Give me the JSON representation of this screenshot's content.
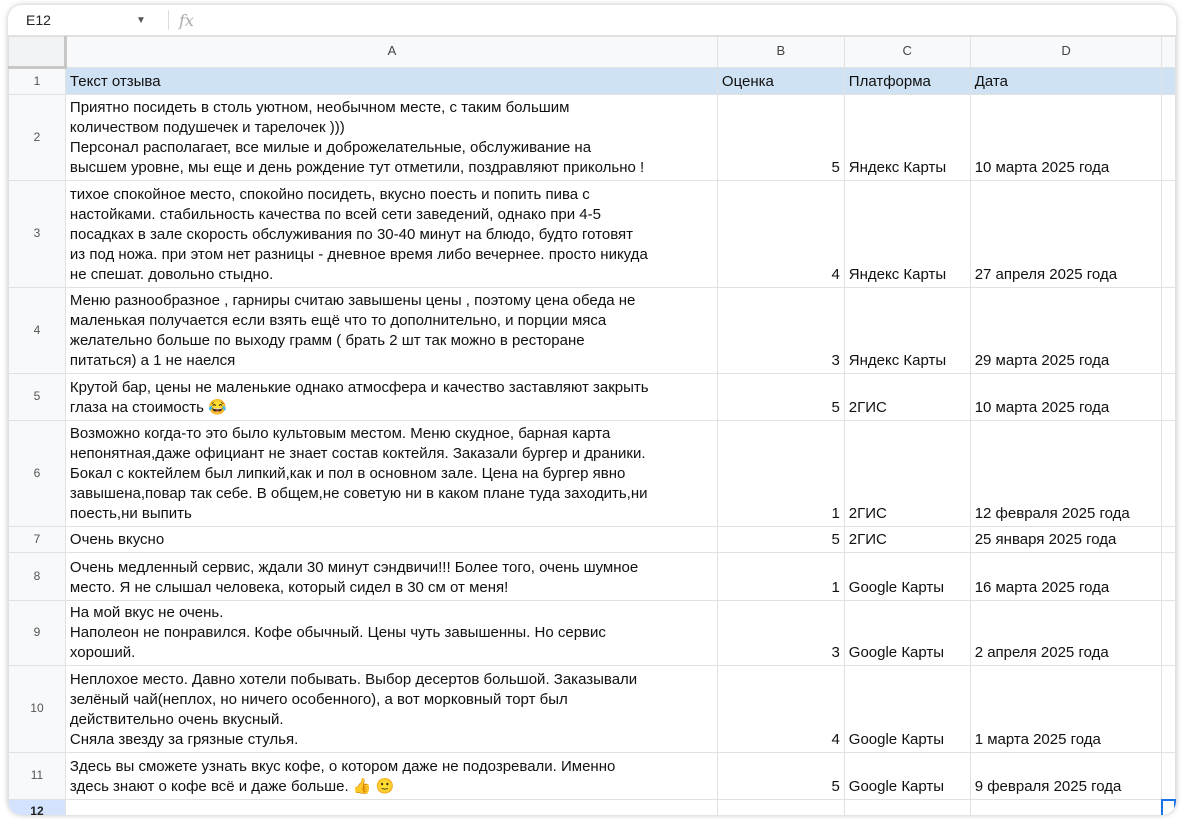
{
  "formula_bar": {
    "cell_ref": "E12",
    "fx_label": "fx"
  },
  "columns": [
    "A",
    "B",
    "C",
    "D"
  ],
  "header": {
    "row": "1",
    "cells": [
      "Текст отзыва",
      "Оценка",
      "Платформа",
      "Дата"
    ]
  },
  "rows": [
    {
      "row": "2",
      "text": "Приятно посидеть в столь уютном, необычном месте, с таким большим\nколичеством подушечек и тарелочек )))\nПерсонал располагает, все милые и доброжелательные, обслуживание на\nвысшем уровне, мы еще и день рождение тут отметили, поздравляют прикольно !",
      "rating": "5",
      "platform": "Яндекс Карты",
      "date": "10 марта 2025 года"
    },
    {
      "row": "3",
      "text": "тихое спокойное место, спокойно посидеть, вкусно поесть и попить пива с\nнастойками. стабильность качества по всей сети заведений, однако при 4-5\nпосадках в зале скорость обслуживания по 30-40 минут на блюдо, будто готовят\nиз под ножа. при этом нет разницы - дневное время либо вечернее. просто никуда\nне спешат. довольно стыдно.",
      "rating": "4",
      "platform": "Яндекс Карты",
      "date": "27 апреля 2025 года"
    },
    {
      "row": "4",
      "text": "Меню разнообразное , гарниры считаю завышены цены , поэтому цена обеда не\nмаленькая получается если взять ещё что то дополнительно, и порции мяса\nжелательно больше по выходу грамм ( брать 2 шт так можно в ресторане\nпитаться) а 1 не наелся",
      "rating": "3",
      "platform": "Яндекс Карты",
      "date": "29 марта 2025 года"
    },
    {
      "row": "5",
      "text": "Крутой бар, цены не маленькие однако атмосфера и качество заставляют закрыть\nглаза на стоимость 😂",
      "rating": "5",
      "platform": "2ГИС",
      "date": "10 марта 2025 года"
    },
    {
      "row": "6",
      "text": "Возможно когда-то это было культовым местом. Меню скудное, барная карта\nнепонятная,даже официант не знает состав коктейля. Заказали бургер и драники.\nБокал с коктейлем был липкий,как и пол в основном зале. Цена на бургер явно\nзавышена,повар так себе. В общем,не советую ни в каком плане туда заходить,ни\nпоесть,ни выпить",
      "rating": "1",
      "platform": "2ГИС",
      "date": "12 февраля 2025 года"
    },
    {
      "row": "7",
      "text": "Очень вкусно",
      "rating": "5",
      "platform": "2ГИС",
      "date": "25 января 2025 года"
    },
    {
      "row": "8",
      "text": "Очень медленный сервис, ждали 30 минут сэндвичи!!! Более того, очень шумное\nместо. Я не слышал человека, который сидел в 30 см от меня!",
      "rating": "1",
      "platform": "Google Карты",
      "date": "16 марта 2025 года"
    },
    {
      "row": "9",
      "text": "На мой вкус не очень.\nНаполеон не понравился. Кофе обычный. Цены чуть завышенны. Но сервис\nхороший.",
      "rating": "3",
      "platform": "Google Карты",
      "date": "2 апреля 2025 года"
    },
    {
      "row": "10",
      "text": "Неплохое место. Давно хотели побывать. Выбор десертов большой. Заказывали\nзелёный чай(неплох, но ничего особенного), а вот морковный торт был\nдействительно очень вкусный.\nСняла звезду за грязные стулья.",
      "rating": "4",
      "platform": "Google Карты",
      "date": "1 марта 2025 года"
    },
    {
      "row": "11",
      "text": "Здесь вы сможете узнать вкус кофе, о котором даже не подозревали. Именно\nздесь знают о кофе всё и даже больше. 👍 🙂",
      "rating": "5",
      "platform": "Google Карты",
      "date": "9 февраля 2025 года"
    }
  ],
  "empty_row": "12"
}
